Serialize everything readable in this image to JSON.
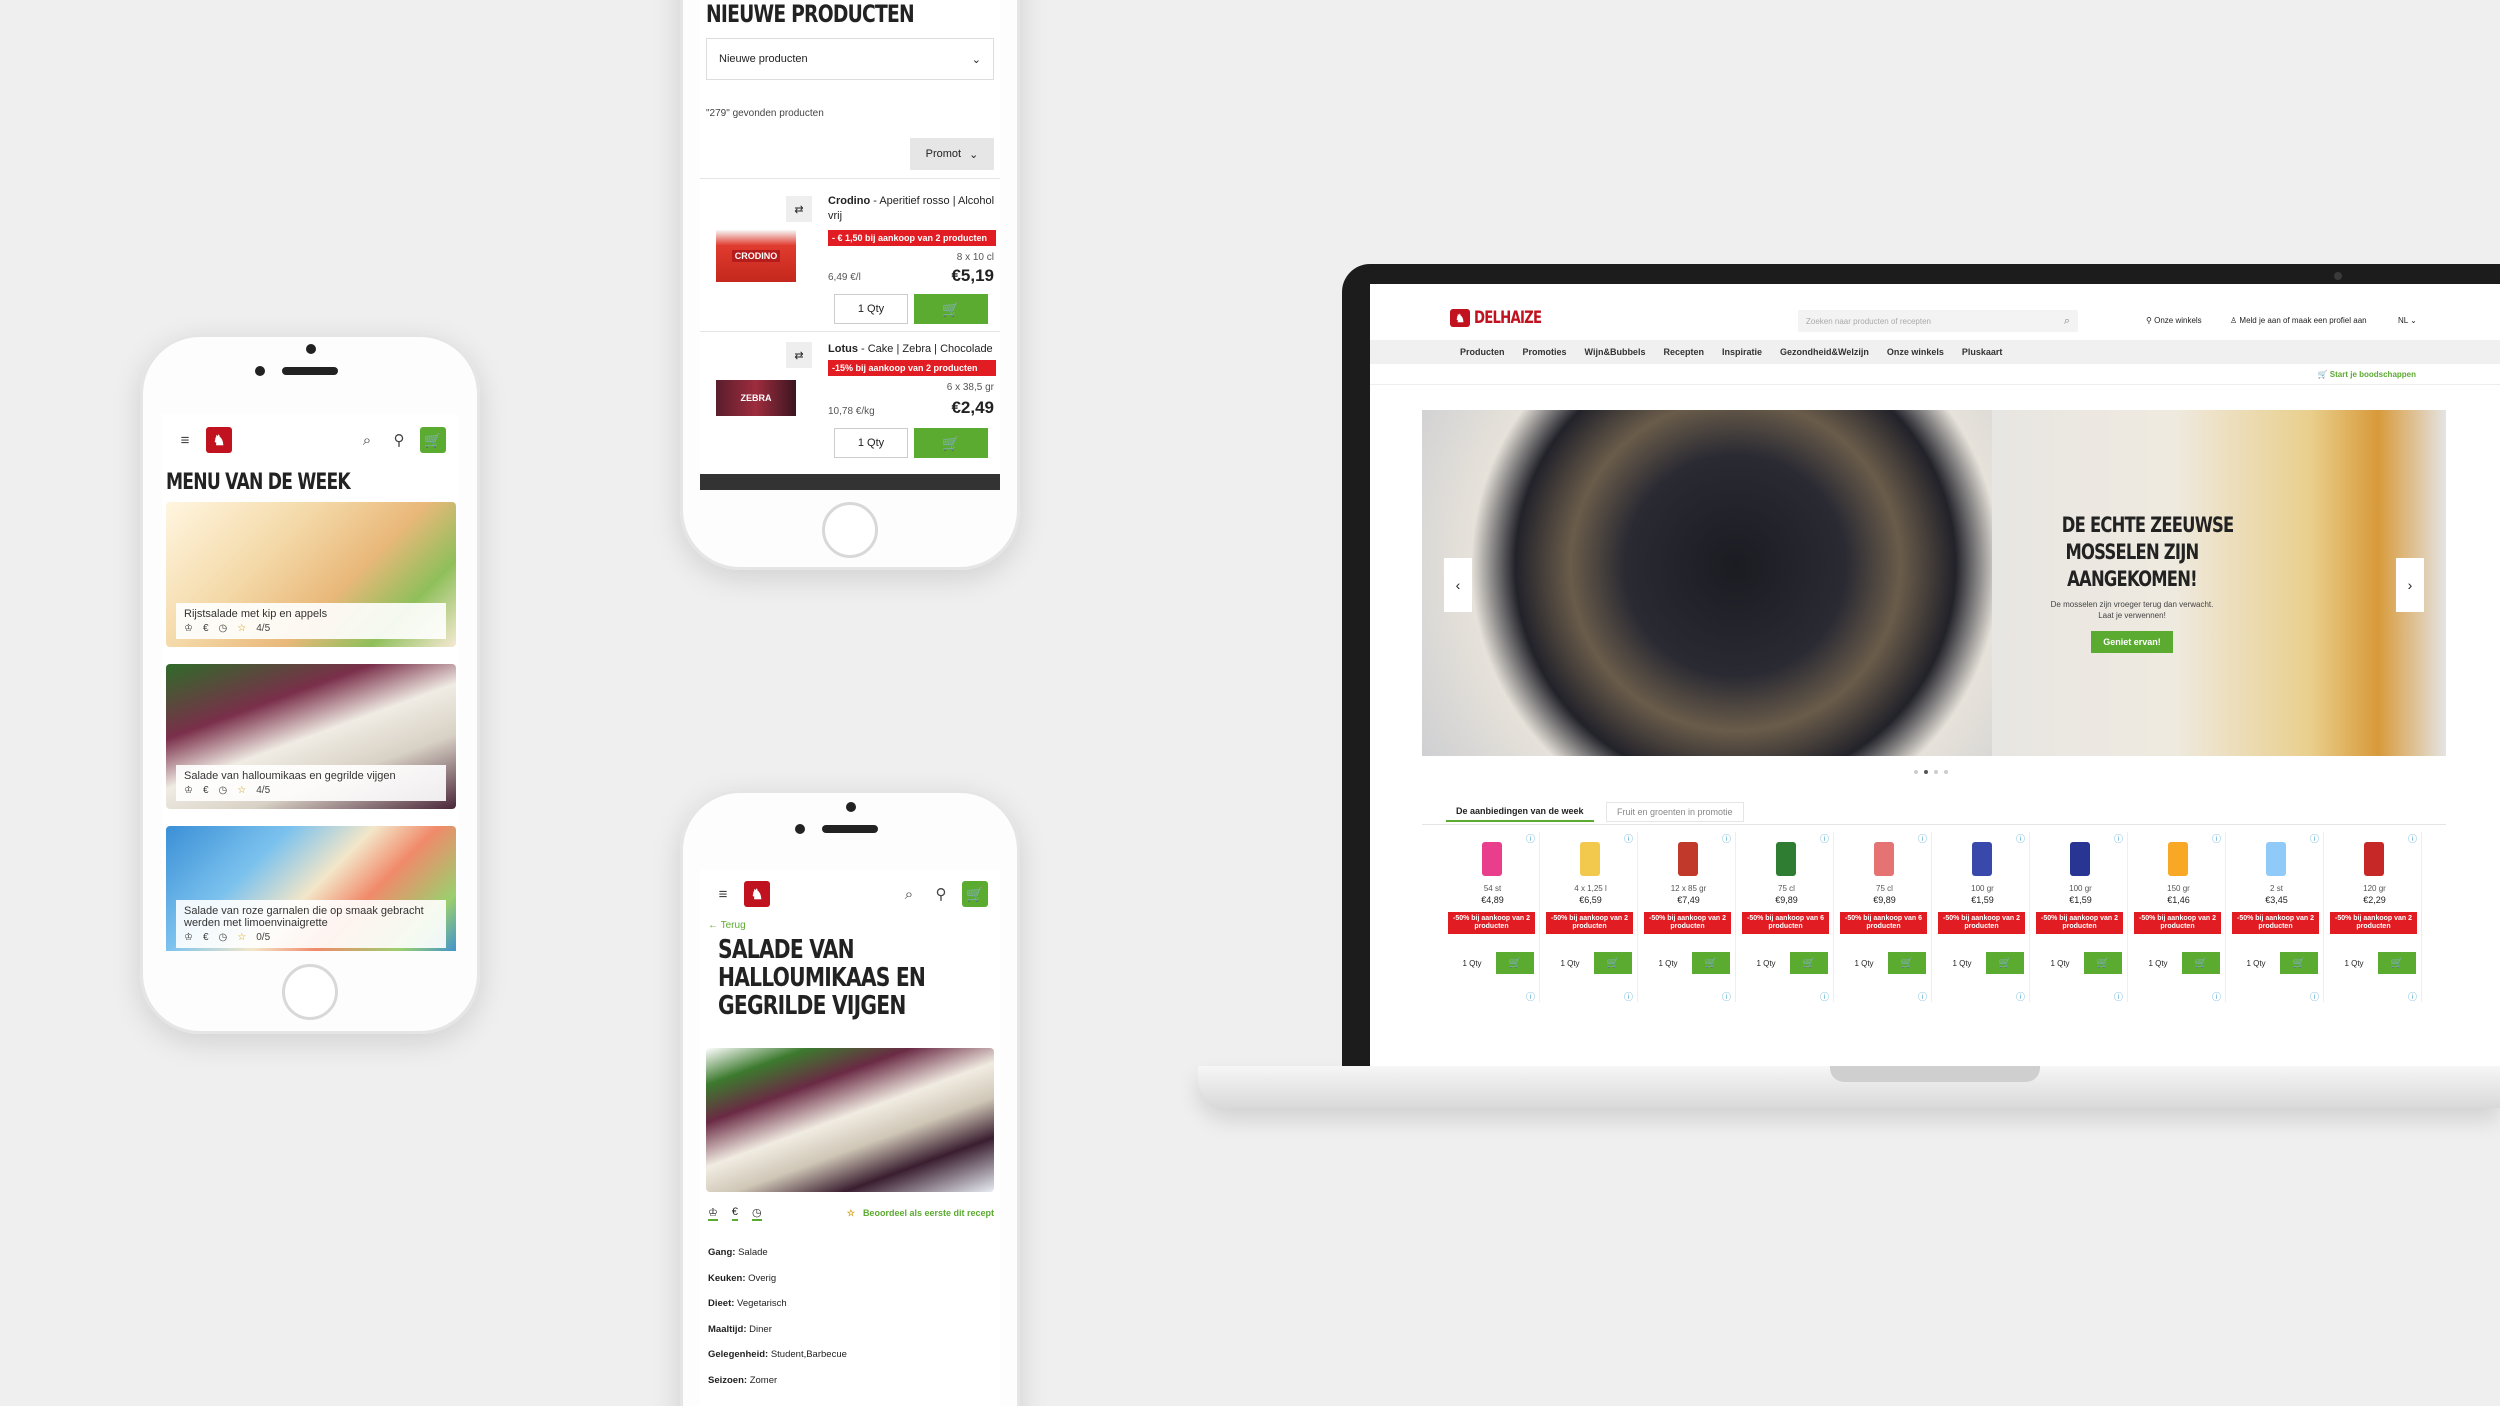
{
  "phone_menu": {
    "title": "MENU VAN DE WEEK",
    "recipes": [
      {
        "name": "Rijstsalade met kip en appels",
        "rating": "4/5"
      },
      {
        "name": "Salade van halloumikaas en gegrilde vijgen",
        "rating": "4/5"
      },
      {
        "name": "Salade van roze garnalen die op smaak gebracht werden met limoenvinaigrette",
        "rating": "0/5"
      }
    ]
  },
  "phone_products": {
    "title": "NIEUWE PRODUCTEN",
    "sort_select": "Nieuwe producten",
    "found": "\"279\" gevonden producten",
    "filter": "Promot",
    "items": [
      {
        "brand": "Crodino",
        "desc": " - Aperitief rosso | Alcohol vrij",
        "promo": "- € 1,50 bij aankoop van 2 producten",
        "size": "8 x 10 cl",
        "unit_price": "6,49 €/l",
        "price": "€5,19",
        "qty": "1 Qty",
        "img_text": "CRODINO"
      },
      {
        "brand": "Lotus",
        "desc": " - Cake | Zebra | Chocolade",
        "promo": "-15% bij aankoop van 2 producten",
        "size": "6 x 38,5 gr",
        "unit_price": "10,78 €/kg",
        "price": "€2,49",
        "qty": "1 Qty",
        "img_text": "ZEBRA"
      }
    ]
  },
  "phone_recipe": {
    "back": "Terug",
    "title_lines": [
      "SALADE VAN",
      "HALLOUMIKAAS EN",
      "GEGRILDE VIJGEN"
    ],
    "rate_cta": "Beoordeel als eerste dit recept",
    "details": [
      {
        "label": "Gang:",
        "value": "Salade"
      },
      {
        "label": "Keuken:",
        "value": "Overig"
      },
      {
        "label": "Dieet:",
        "value": "Vegetarisch"
      },
      {
        "label": "Maaltijd:",
        "value": "Diner"
      },
      {
        "label": "Gelegenheid:",
        "value": "Student,Barbecue"
      },
      {
        "label": "Seizoen:",
        "value": "Zomer"
      }
    ]
  },
  "desktop": {
    "logo": "DELHAIZE",
    "search_placeholder": "Zoeken naar producten of recepten",
    "stores": "Onze winkels",
    "login": "Meld je aan of maak een profiel aan",
    "lang": "NL",
    "nav": [
      "Producten",
      "Promoties",
      "Wijn&Bubbels",
      "Recepten",
      "Inspiratie",
      "Gezondheid&Welzijn",
      "Onze winkels",
      "Pluskaart"
    ],
    "start_shopping": "Start je boodschappen",
    "hero": {
      "title_lines": [
        "DE ECHTE ZEEUWSE",
        "MOSSELEN ZIJN",
        "AANGEKOMEN!"
      ],
      "text": "De mosselen zijn vroeger terug dan verwacht. Laat je verwennen!",
      "cta": "Geniet ervan!"
    },
    "tabs": [
      "De aanbiedingen van de week",
      "Fruit en groenten in promotie"
    ],
    "products": [
      {
        "size": "54 st",
        "price": "€4,89",
        "promo": "-50% bij aankoop van 2 producten",
        "color": "#e83e8c"
      },
      {
        "size": "4 x 1,25 l",
        "price": "€6,59",
        "promo": "-50% bij aankoop van 2 producten",
        "color": "#f2c94c"
      },
      {
        "size": "12 x 85 gr",
        "price": "€7,49",
        "promo": "-50% bij aankoop van 2 producten",
        "color": "#c0392b"
      },
      {
        "size": "75 cl",
        "price": "€9,89",
        "promo": "-50% bij aankoop van 6 producten",
        "color": "#2e7d32"
      },
      {
        "size": "75 cl",
        "price": "€9,89",
        "promo": "-50% bij aankoop van 6 producten",
        "color": "#e57373"
      },
      {
        "size": "100 gr",
        "price": "€1,59",
        "promo": "-50% bij aankoop van 2 producten",
        "color": "#3949ab"
      },
      {
        "size": "100 gr",
        "price": "€1,59",
        "promo": "-50% bij aankoop van 2 producten",
        "color": "#283593"
      },
      {
        "size": "150 gr",
        "price": "€1,46",
        "promo": "-50% bij aankoop van 2 producten",
        "color": "#f9a825"
      },
      {
        "size": "2 st",
        "price": "€3,45",
        "promo": "-50% bij aankoop van 2 producten",
        "color": "#90caf9"
      },
      {
        "size": "120 gr",
        "price": "€2,29",
        "promo": "-50% bij aankoop van 2 producten",
        "color": "#c62828"
      }
    ],
    "qty": "1 Qty"
  }
}
